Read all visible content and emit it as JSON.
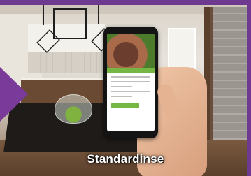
{
  "caption": {
    "label": "Standardinse"
  },
  "colors": {
    "accent": "#6d3a8f",
    "app_green": "#74b744"
  },
  "image": {
    "subject": "hand-holding-phone-in-kitchen"
  }
}
